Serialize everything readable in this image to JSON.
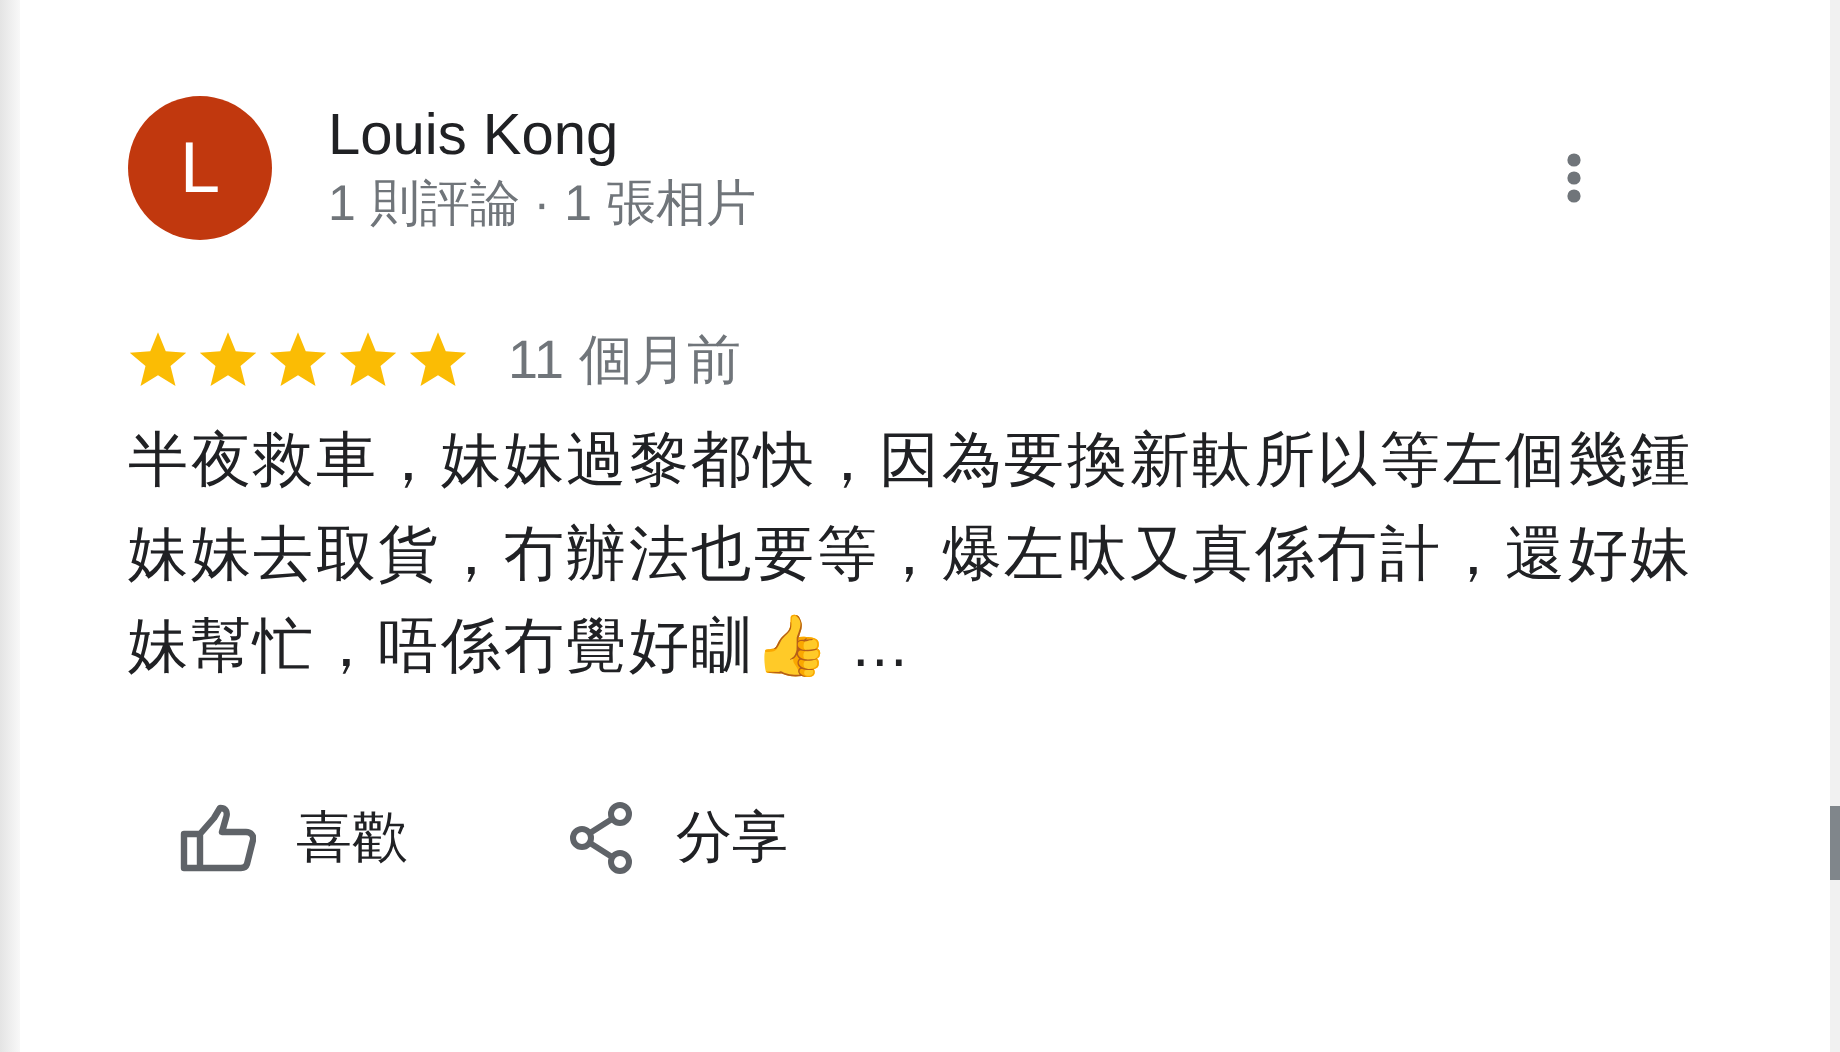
{
  "review": {
    "avatar_letter": "L",
    "author": "Louis Kong",
    "author_stats": "1 則評論 · 1 張相片",
    "stars": 5,
    "time": "11 個月前",
    "text": "半夜救車，妹妹過黎都快，因為要換新軚所以等左個幾鍾妹妹去取貨，冇辦法也要等，爆左呔又真係冇計，還好妹妹幫忙，唔係冇覺好瞓👍 …"
  },
  "actions": [
    {
      "kind": "like",
      "label": "喜歡"
    },
    {
      "kind": "share",
      "label": "分享"
    }
  ]
}
